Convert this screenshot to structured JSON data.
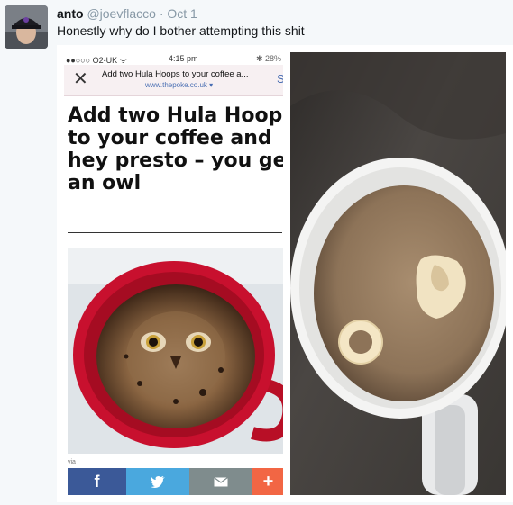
{
  "tweet": {
    "author_name": "anto",
    "handle": "@joevflacco",
    "separator": "·",
    "date": "Oct 1",
    "text": "Honestly why do I bother attempting this shit"
  },
  "phone": {
    "status": {
      "carrier": "●●○○○ O2-UK ᯤ",
      "time": "4:15 pm",
      "battery": "✱ 28%"
    },
    "browser": {
      "close_glyph": "✕",
      "page_title": "Add two Hula Hoops to your coffee a...",
      "page_url": "www.thepoke.co.uk ▾",
      "share_glyph": "S"
    },
    "article": {
      "headline": "Add two Hula Hoops\nto your coffee and\nhey presto – you get\nan owl",
      "via": "via"
    },
    "share_bar": {
      "facebook": "f",
      "twitter": "🐦",
      "email": "✉",
      "more": "+"
    }
  },
  "colors": {
    "facebook": "#3b5998",
    "twitter": "#4aa8de",
    "email": "#7f8c8d",
    "more": "#f26644",
    "cup_red": "#c8102e"
  }
}
